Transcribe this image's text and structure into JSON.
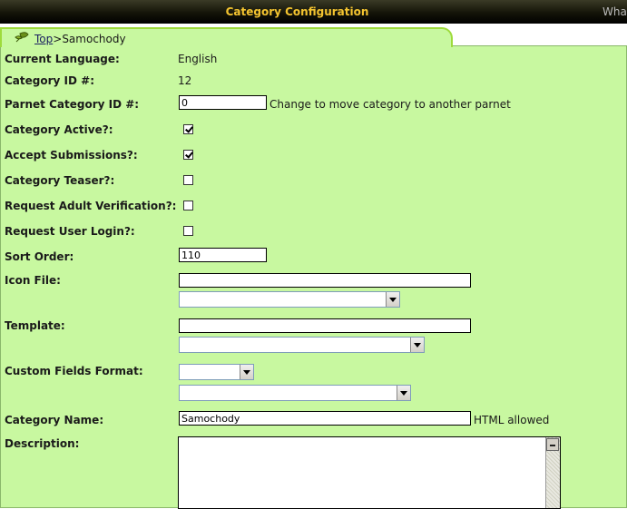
{
  "header": {
    "title": "Category Configuration",
    "right_text": "Wha"
  },
  "breadcrumb": {
    "top_link": "Top",
    "separator": ">",
    "current": "Samochody"
  },
  "form": {
    "current_language": {
      "label": "Current Language:",
      "value": "English"
    },
    "category_id": {
      "label": "Category ID #:",
      "value": "12"
    },
    "parent_category_id": {
      "label": "Parnet Category ID #:",
      "value": "0",
      "note": "Change to move category to another parnet"
    },
    "category_active": {
      "label": "Category Active?:",
      "checked": true
    },
    "accept_submissions": {
      "label": "Accept Submissions?:",
      "checked": true
    },
    "category_teaser": {
      "label": "Category Teaser?:",
      "checked": false
    },
    "adult_verification": {
      "label": "Request Adult Verification?:",
      "checked": false
    },
    "user_login": {
      "label": "Request User Login?:",
      "checked": false
    },
    "sort_order": {
      "label": "Sort Order:",
      "value": "110"
    },
    "icon_file": {
      "label": "Icon File:",
      "value": "",
      "selected": ""
    },
    "template": {
      "label": "Template:",
      "value": "",
      "selected": ""
    },
    "custom_fields_format": {
      "label": "Custom Fields Format:",
      "selected_1": "",
      "selected_2": ""
    },
    "category_name": {
      "label": "Category Name:",
      "value": "Samochody",
      "note": "HTML allowed"
    },
    "description": {
      "label": "Description:",
      "value": ""
    }
  },
  "colors": {
    "panel_bg": "#c8f8a0",
    "header_text": "#f4c430",
    "tab_border": "#9edb3c"
  }
}
